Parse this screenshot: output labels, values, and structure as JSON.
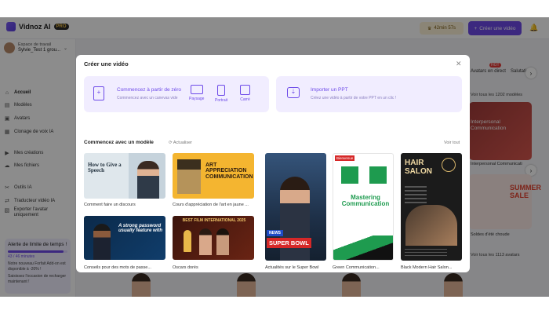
{
  "app": {
    "name": "Vidnoz AI",
    "plan_badge": "PRO"
  },
  "topbar": {
    "credits": "42min 57s",
    "create_label": "Créer une vidéo"
  },
  "workspace": {
    "label": "Espace de travail",
    "name": "Sylvie_Test 1 grou..."
  },
  "sidebar": {
    "items": [
      {
        "label": "Accueil",
        "icon": "home-icon"
      },
      {
        "label": "Modèles",
        "icon": "templates-icon"
      },
      {
        "label": "Avatars",
        "icon": "avatar-icon"
      },
      {
        "label": "Clonage de voix IA",
        "icon": "voice-icon"
      },
      {
        "label": "Mes créations",
        "icon": "video-icon"
      },
      {
        "label": "Mes fichiers",
        "icon": "cloud-icon"
      },
      {
        "label": "Outils IA",
        "icon": "tools-icon"
      },
      {
        "label": "Traducteur vidéo IA",
        "icon": "translate-icon"
      },
      {
        "label": "Exporter l'avatar uniquement",
        "icon": "export-icon"
      }
    ]
  },
  "alert": {
    "title": "Alerte de limite de temps !",
    "progress_text": "43 / 46 minutes",
    "progress": 0.93,
    "message1": "Notre nouveau Forfait Add-on est disponible à -20% !",
    "message2": "Saisissez l'occasion de recharger maintenant !"
  },
  "background": {
    "tab1": "Avatars en direct",
    "tab1_badge": "HOT",
    "tab2": "Salutati",
    "see_all_text": "Voir tous les 1202 modèles",
    "card1_text": "Interpersonal Communication",
    "card1_caption": "Interpersonal Communicati",
    "card2_text": "SUMMER SALE",
    "card2_caption": "Soldes d'été choude",
    "see_all_avatars": "Voir tous les 1113 avatars"
  },
  "modal": {
    "title": "Créer une vidéo",
    "start_zero": {
      "title": "Commencez à partir de zéro",
      "subtitle": "Commencez avec un canevas vide",
      "formats": [
        "Paysage",
        "Portrait",
        "Carré"
      ]
    },
    "import_ppt": {
      "title": "Importer un PPT",
      "subtitle": "Créez une vidéo à partir de votre PPT en un clic !"
    },
    "section_title": "Commencez avec un modèle",
    "refresh_label": "Actualiser",
    "see_all_label": "Voir tout",
    "templates": [
      {
        "caption": "Comment faire un discours",
        "text": "How to Give a Speech"
      },
      {
        "caption": "Cours d'appréciation de l'art en jaune ...",
        "text": "ART APPRECIATION COMMUNICATION"
      },
      {
        "caption": "Conseils pour des mots de passe...",
        "text": "A strong password usually feature with"
      },
      {
        "caption": "Oscars dorés",
        "text": "BEST FILM INTERNATIONAL 2025"
      },
      {
        "caption": "Actualités sur le Super Bowl",
        "text": "SUPER BOWL",
        "badge": "NEWS"
      },
      {
        "caption": "Green Communication...",
        "text": "Mastering Communication",
        "badge": "Bienvenue"
      },
      {
        "caption": "Black Modern Hair Salon...",
        "text": "HAIR SALON"
      }
    ]
  }
}
